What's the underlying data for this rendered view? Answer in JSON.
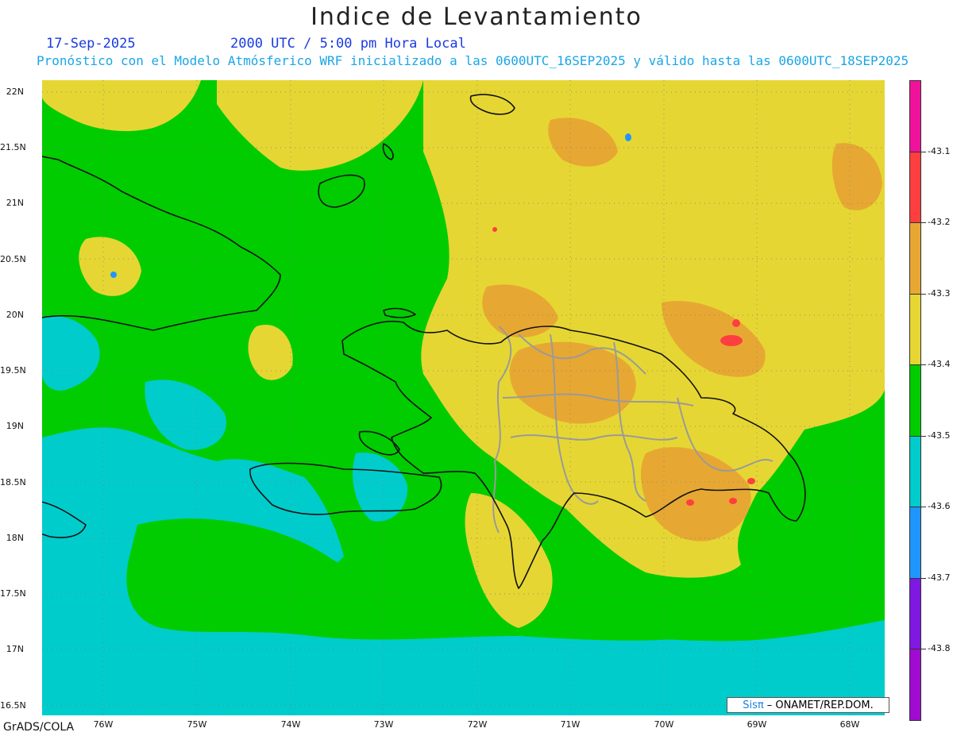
{
  "header": {
    "title": "Indice de Levantamiento",
    "date": "17-Sep-2025",
    "time": "2000 UTC / 5:00 pm Hora Local",
    "description": "Pronóstico con el Modelo Atmósferico WRF inicializado a las 0600UTC_16SEP2025 y válido hasta las  0600UTC_18SEP2025"
  },
  "map": {
    "lat_labels": [
      "22N",
      "21.5N",
      "21N",
      "20.5N",
      "20N",
      "19.5N",
      "19N",
      "18.5N",
      "18N",
      "17.5N",
      "17N",
      "16.5N"
    ],
    "lon_labels": [
      "76W",
      "75W",
      "74W",
      "73W",
      "72W",
      "71W",
      "70W",
      "69W",
      "68W"
    ],
    "field_colors": {
      "cyan": "#00cccc",
      "green": "#00cc00",
      "yellow": "#e6d633",
      "orange": "#e6a833",
      "red": "#ff3f3f",
      "coast": "#111111",
      "provinces": "#9a9a9a"
    }
  },
  "colorbar": {
    "levels": [
      "-43.1",
      "-43.2",
      "-43.3",
      "-43.4",
      "-43.5",
      "-43.6",
      "-43.7",
      "-43.8"
    ],
    "colors": [
      "#f0129b",
      "#ff3f3f",
      "#e6a833",
      "#e6d633",
      "#00cc00",
      "#00cccc",
      "#1f96ff",
      "#7f18e0",
      "#a00bd0"
    ]
  },
  "footer": {
    "software": "GrADS/COLA",
    "credit_brand": "Sisπ",
    "credit_text": "– ONAMET/REP.DOM."
  }
}
